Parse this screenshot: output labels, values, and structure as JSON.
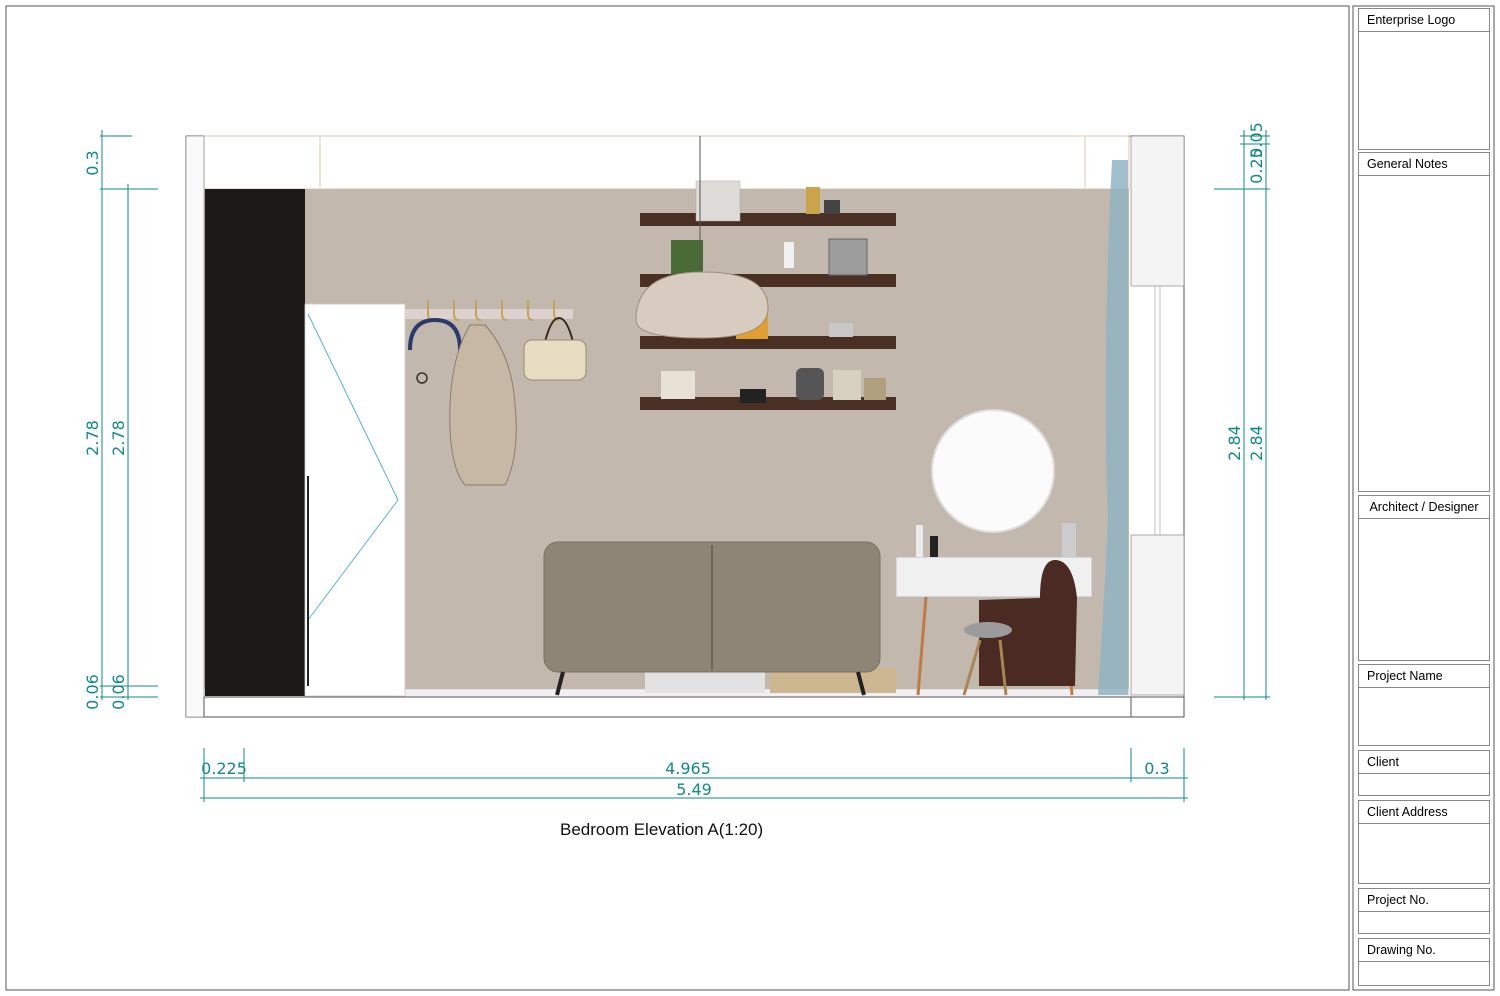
{
  "drawing": {
    "caption": "Bedroom Elevation A(1:20)",
    "dimensions": {
      "left_top_a": "0.3",
      "left_mid_a": "2.78",
      "left_mid_b": "2.78",
      "left_bottom_a": "0.06",
      "left_bottom_b": "0.06",
      "right_top_a": "0.05",
      "right_top_b": "0.25",
      "right_mid_a": "2.84",
      "right_mid_b": "2.84",
      "bottom_left": "0.225",
      "bottom_mid": "4.965",
      "bottom_right": "0.3",
      "bottom_total": "5.49"
    }
  },
  "title_block": {
    "enterprise_logo": "Enterprise Logo",
    "general_notes": "General Notes",
    "architect": "Architect / Designer",
    "project_name": "Project Name",
    "client": "Client",
    "client_address": "Client Address",
    "project_no": "Project No.",
    "drawing_no": "Drawing No."
  },
  "colors": {
    "dimension": "#128a8a",
    "wall": "#c3b8ad",
    "wardrobe_dark": "#1c1a19",
    "shelf": "#4a2f24",
    "sofa": "#8f8577",
    "chair": "#4a2a22",
    "curtain": "#8fb3c2"
  }
}
